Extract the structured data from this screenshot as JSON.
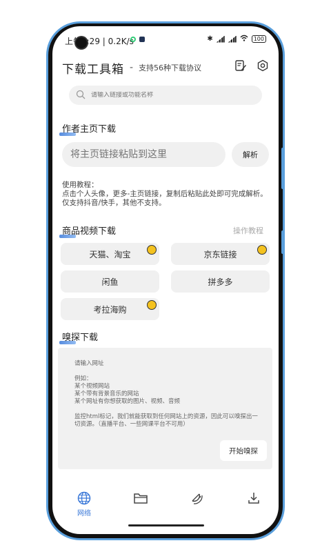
{
  "status_bar": {
    "time": "上午9:29",
    "speed": "0.2K/s",
    "battery": "100"
  },
  "header": {
    "title": "下载工具箱",
    "dash": "-",
    "subtitle": "支持56种下载协议"
  },
  "search": {
    "placeholder": "请输入链接或功能名称"
  },
  "author_section": {
    "title": "作者主页下载",
    "input_placeholder": "将主页链接粘贴到这里",
    "parse_label": "解析",
    "tutorial": "使用教程：\n点击个人头像，更多-主页链接，复制后粘贴此处即可完成解析。仅支持抖音/快手，其他不支持。"
  },
  "product_section": {
    "title": "商品视频下载",
    "tutorial_link": "操作教程",
    "buttons": [
      {
        "label": "天猫、淘宝",
        "hot": true
      },
      {
        "label": "京东链接",
        "hot": true
      },
      {
        "label": "闲鱼",
        "hot": false
      },
      {
        "label": "拼多多",
        "hot": false
      },
      {
        "label": "考拉海购",
        "hot": true
      }
    ]
  },
  "sniff_section": {
    "title": "嗅探下载",
    "placeholder": "请输入网址\n\n例如：\n某个视频网站\n某个带有背景音乐的网站\n某个网址有你想获取的图片、视频、音频\n\n监控html标记，我们就能获取到任何网站上的资源，因此可以嗅探出一切资源。（直播平台、一些网课平台不可用）",
    "start_label": "开始嗅探"
  },
  "bottom_nav": {
    "items": [
      {
        "label": "网络",
        "icon": "globe-icon",
        "active": true
      },
      {
        "label": "",
        "icon": "folder-icon",
        "active": false
      },
      {
        "label": "",
        "icon": "satellite-icon",
        "active": false
      },
      {
        "label": "",
        "icon": "download-icon",
        "active": false
      }
    ]
  },
  "colors": {
    "accent": "#3a78d8",
    "frame": "#5a9fdc"
  }
}
